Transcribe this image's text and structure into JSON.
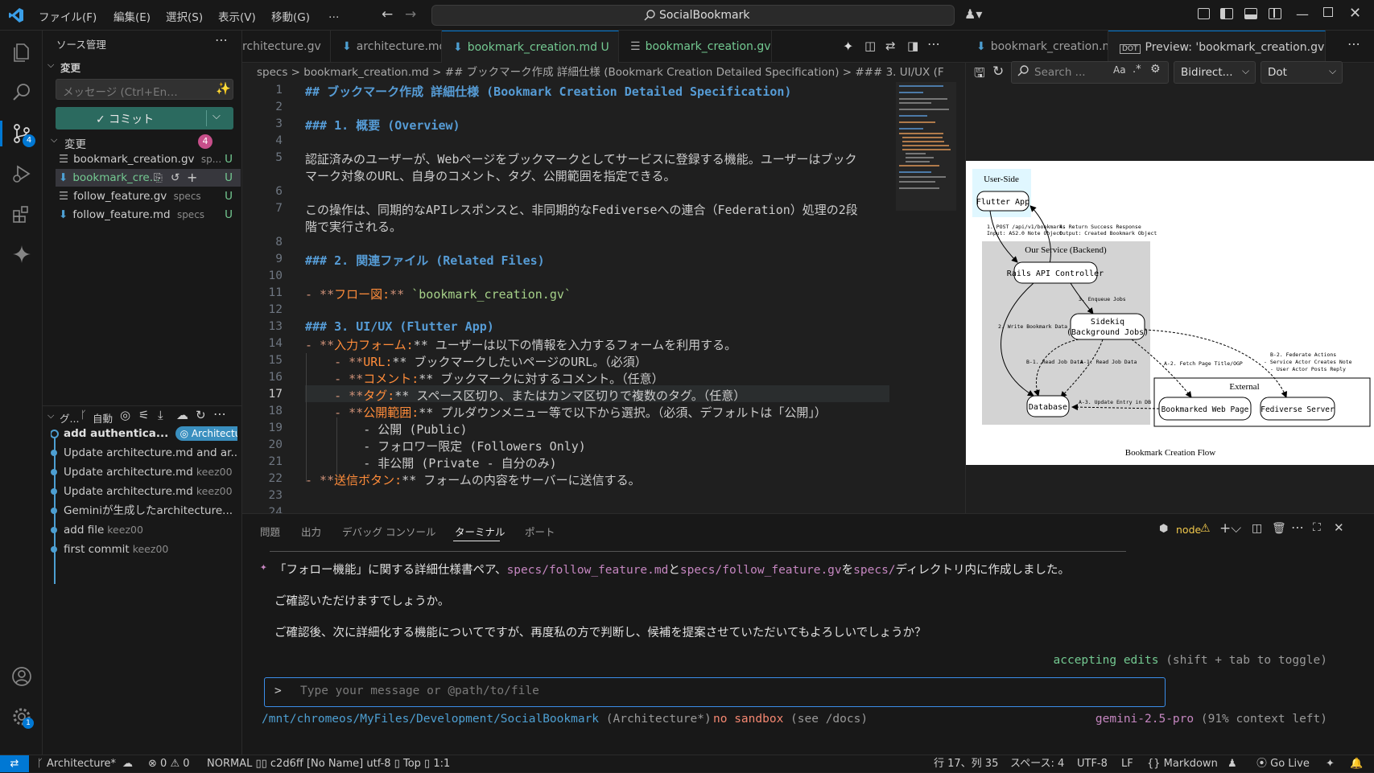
{
  "titlebar": {
    "menus": [
      "ファイル(F)",
      "編集(E)",
      "選択(S)",
      "表示(V)",
      "移動(G)",
      "…"
    ],
    "search": "SocialBookmark"
  },
  "sidebar": {
    "title": "ソース管理",
    "section_changes": "変更",
    "message_placeholder": "メッセージ (Ctrl+En…",
    "commit_label": "✓ コミット",
    "changes_header": "変更",
    "changes_count": "4",
    "files": [
      {
        "name": "bookmark_creation.gv",
        "dir": "sp...",
        "status": "U"
      },
      {
        "name": "bookmark_cre...",
        "dir": "",
        "status": "U"
      },
      {
        "name": "follow_feature.gv",
        "dir": "specs",
        "status": "U"
      },
      {
        "name": "follow_feature.md",
        "dir": "specs",
        "status": "U"
      }
    ],
    "graph_header": "グ...",
    "graph_auto": "自動",
    "graph": [
      {
        "msg": "add authentica...",
        "badge": "Architecture",
        "author": ""
      },
      {
        "msg": "Update architecture.md and ar...",
        "author": ""
      },
      {
        "msg": "Update architecture.md",
        "author": "keez00"
      },
      {
        "msg": "Update architecture.md",
        "author": "keez00"
      },
      {
        "msg": "Geminiが生成したarchitecture...",
        "author": ""
      },
      {
        "msg": "add file",
        "author": "keez00"
      },
      {
        "msg": "first commit",
        "author": "keez00"
      }
    ]
  },
  "tabs": {
    "t1": "rchitecture.gv",
    "t2": "architecture.md",
    "t3": "bookmark_creation.md",
    "t3_status": "U",
    "t4": "bookmark_creation.gv",
    "t4_status": "U",
    "t5": "bookmark_creation.md",
    "t6": "Preview: 'bookmark_creation.gv'"
  },
  "breadcrumb": "specs  >  bookmark_creation.md  >  ## ブックマーク作成 詳細仕様 (Bookmark Creation Detailed Specification)  >  ### 3. UI/UX (F",
  "editor": {
    "line_numbers": [
      "1",
      "2",
      "3",
      "4",
      "5",
      "",
      "6",
      "7",
      "",
      "8",
      "9",
      "10",
      "11",
      "12",
      "13",
      "14",
      "15",
      "16",
      "17",
      "18",
      "19",
      "20",
      "21",
      "22",
      "23",
      "24"
    ],
    "l1": "## ブックマーク作成 詳細仕様 (Bookmark Creation Detailed Specification)",
    "l3": "### 1. 概要 (Overview)",
    "l5a": "認証済みのユーザーが、Webページをブックマークとしてサービスに登録する機能。ユーザーはブック",
    "l5b": "マーク対象のURL、自身のコメント、タグ、公開範囲を指定できる。",
    "l7a": "この操作は、同期的なAPIレスポンスと、非同期的なFediverseへの連合（Federation）処理の2段",
    "l7b": "階で実行される。",
    "l9": "### 2. 関連ファイル (Related Files)",
    "l11a": "- **",
    "l11b": "フロー図:",
    "l11c": "** ",
    "l11d": "`bookmark_creation.gv`",
    "l13": "### 3. UI/UX (Flutter App)",
    "l15a": "- **",
    "l15b": "入力フォーム:",
    "l15c": "** ユーザーは以下の情報を入力するフォームを利用する。",
    "l16a": "    - **",
    "l16b": "URL:",
    "l16c": "** ブックマークしたいページのURL。（必須）",
    "l17a": "    - **",
    "l17b": "コメント:",
    "l17c": "** ブックマークに対するコメント。（任意）",
    "l18a": "    - **",
    "l18b": "タグ:",
    "l18c": "** スペース区切り、またはカンマ区切りで複数のタグ。（任意）",
    "l19a": "    - **",
    "l19b": "公開範囲:",
    "l19c": "** プルダウンメニュー等で以下から選択。（必須、デフォルトは「公開」）",
    "l20": "        - 公開 (Public)",
    "l21": "        - フォロワー限定 (Followers Only)",
    "l22": "        - 非公開 (Private - 自分のみ)",
    "l23a": "- **",
    "l23b": "送信ボタン:",
    "l23c": "** フォームの内容をサーバーに送信する。"
  },
  "preview": {
    "search_placeholder": "Search ...",
    "aa": "Aa",
    "dir_select": "Bidirect...",
    "engine_select": "Dot",
    "graph": {
      "user_side": "User-Side",
      "flutter": "Flutter App",
      "edge1a": "1. POST /api/v1/bookmarks",
      "edge1b": "Input: AS2.0 Note Object",
      "edge4a": "4. Return Success Response",
      "edge4b": "Output: Created Bookmark Object",
      "backend": "Our Service (Backend)",
      "rails": "Rails API Controller",
      "enqueue": "3. Enqueue Jobs",
      "write": "2. Write Bookmark Data",
      "sidekiq1": "Sidekiq",
      "sidekiq2": "(Background Jobs)",
      "b1": "B-1. Read Job Data",
      "a1": "A-1. Read Job Data",
      "a2": "A-2. Fetch Page Title/OGP",
      "b2a": "B-2. Federate Actions",
      "b2b": "- Service Actor Creates Note",
      "b2c": "- User Actor Posts Reply",
      "database": "Database",
      "a3": "A-3. Update Entry in DB",
      "external": "External",
      "webpage": "Bookmarked Web Page",
      "fediverse": "Fediverse Server",
      "caption": "Bookmark Creation Flow"
    }
  },
  "panel": {
    "tabs": [
      "問題",
      "出力",
      "デバッグ コンソール",
      "ターミナル",
      "ポート"
    ],
    "node": "node",
    "msg1a": "「フォロー機能」に関する詳細仕様書ペア、",
    "msg1b": "specs/follow_feature.md",
    "msg1c": "と",
    "msg1d": "specs/follow_feature.gv",
    "msg1e": "を",
    "msg1f": "specs/",
    "msg1g": "ディレクトリ内に作成しました。",
    "msg2": "ご確認いただけますでしょうか。",
    "msg3": "ご確認後、次に詳細化する機能についてですが、再度私の方で判断し、候補を提案させていただいてもよろしいでしょうか？",
    "accepting": "accepting edits",
    "toggle": "(shift + tab to toggle)",
    "prompt": ">",
    "input_placeholder": "Type your message or @path/to/file",
    "path": "/mnt/chromeos/MyFiles/Development/SocialBookmark",
    "branch": "(Architecture*)",
    "sandbox": "no sandbox",
    "sandbox_hint": "(see /docs)",
    "model": "gemini-2.5-pro",
    "context": "(91% context left)"
  },
  "status": {
    "branch": "Architecture*",
    "errors": "0",
    "warnings": "0",
    "vim": "NORMAL ▯▯ c2d6ff [No Name] utf-8 ▯ Top ▯ 1:1",
    "position": "行 17、列 35",
    "spaces": "スペース: 4",
    "encoding": "UTF-8",
    "eol": "LF",
    "language": "{} Markdown",
    "golive": "Go Live",
    "notif": "1"
  },
  "colors": {
    "accent": "#0078d4",
    "badge": "#c74f8a",
    "untracked": "#73c991",
    "link": "#c586c0"
  }
}
